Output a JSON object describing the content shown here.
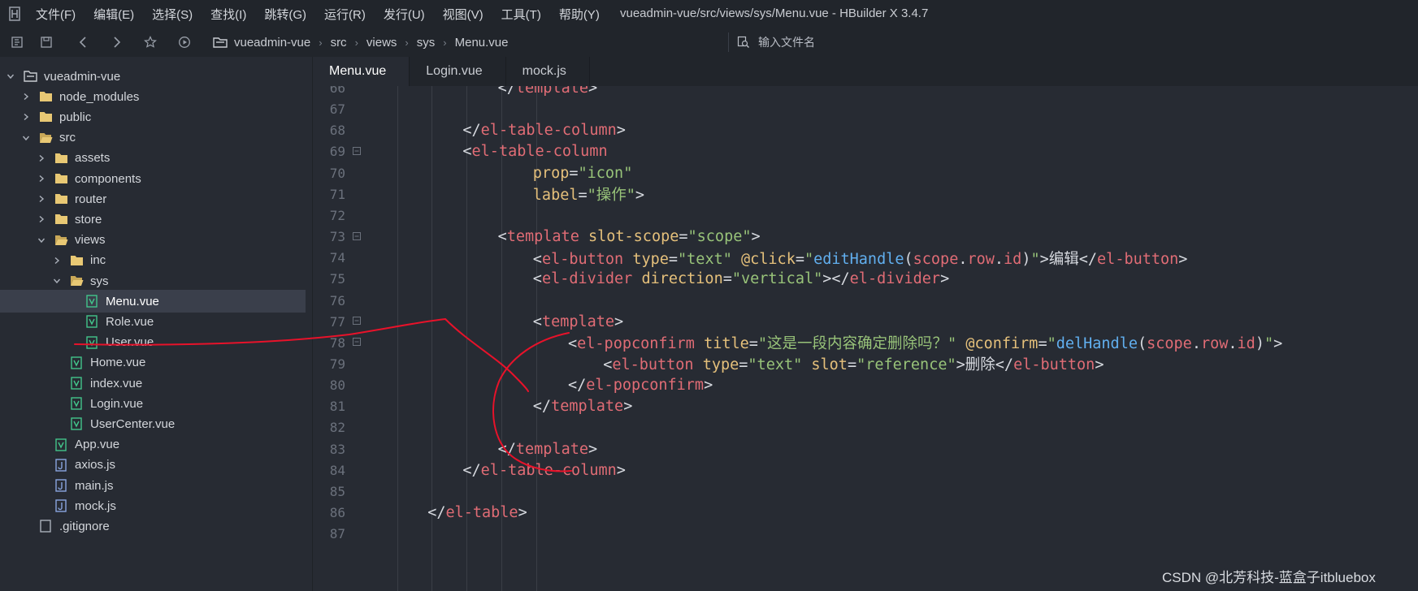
{
  "window": {
    "title": "vueadmin-vue/src/views/sys/Menu.vue - HBuilder X 3.4.7",
    "menu": [
      "文件(F)",
      "编辑(E)",
      "选择(S)",
      "查找(I)",
      "跳转(G)",
      "运行(R)",
      "发行(U)",
      "视图(V)",
      "工具(T)",
      "帮助(Y)"
    ]
  },
  "toolbar": {
    "icons": [
      "sidebar-toggle-icon",
      "save-icon",
      "back-icon",
      "forward-icon",
      "star-icon",
      "run-icon"
    ],
    "breadcrumb": [
      "vueadmin-vue",
      "src",
      "views",
      "sys",
      "Menu.vue"
    ],
    "search_placeholder": "输入文件名"
  },
  "sidebar": {
    "items": [
      {
        "label": "vueadmin-vue",
        "level": 0,
        "type": "project",
        "expanded": true
      },
      {
        "label": "node_modules",
        "level": 1,
        "type": "folder",
        "expanded": false
      },
      {
        "label": "public",
        "level": 1,
        "type": "folder",
        "expanded": false
      },
      {
        "label": "src",
        "level": 1,
        "type": "folder",
        "expanded": true
      },
      {
        "label": "assets",
        "level": 2,
        "type": "folder",
        "expanded": false
      },
      {
        "label": "components",
        "level": 2,
        "type": "folder",
        "expanded": false
      },
      {
        "label": "router",
        "level": 2,
        "type": "folder",
        "expanded": false
      },
      {
        "label": "store",
        "level": 2,
        "type": "folder",
        "expanded": false
      },
      {
        "label": "views",
        "level": 2,
        "type": "folder",
        "expanded": true
      },
      {
        "label": "inc",
        "level": 3,
        "type": "folder",
        "expanded": false
      },
      {
        "label": "sys",
        "level": 3,
        "type": "folder",
        "expanded": true
      },
      {
        "label": "Menu.vue",
        "level": 4,
        "type": "vue",
        "selected": true
      },
      {
        "label": "Role.vue",
        "level": 4,
        "type": "vue"
      },
      {
        "label": "User.vue",
        "level": 4,
        "type": "vue"
      },
      {
        "label": "Home.vue",
        "level": 3,
        "type": "vue"
      },
      {
        "label": "index.vue",
        "level": 3,
        "type": "vue"
      },
      {
        "label": "Login.vue",
        "level": 3,
        "type": "vue"
      },
      {
        "label": "UserCenter.vue",
        "level": 3,
        "type": "vue"
      },
      {
        "label": "App.vue",
        "level": 2,
        "type": "vue"
      },
      {
        "label": "axios.js",
        "level": 2,
        "type": "js"
      },
      {
        "label": "main.js",
        "level": 2,
        "type": "js"
      },
      {
        "label": "mock.js",
        "level": 2,
        "type": "js"
      },
      {
        "label": ".gitignore",
        "level": 1,
        "type": "file"
      }
    ]
  },
  "tabs": [
    {
      "label": "Menu.vue",
      "active": true
    },
    {
      "label": "Login.vue",
      "active": false
    },
    {
      "label": "mock.js",
      "active": false
    }
  ],
  "editor": {
    "lines": [
      {
        "n": "66",
        "fold": false,
        "indent": 12,
        "tokens": [
          [
            "br",
            "</"
          ],
          [
            "tag",
            "template"
          ],
          [
            "br",
            ">"
          ]
        ]
      },
      {
        "n": "67",
        "fold": false,
        "indent": 0,
        "tokens": []
      },
      {
        "n": "68",
        "fold": false,
        "indent": 8,
        "tokens": [
          [
            "br",
            "</"
          ],
          [
            "tag",
            "el-table-column"
          ],
          [
            "br",
            ">"
          ]
        ]
      },
      {
        "n": "69",
        "fold": true,
        "indent": 8,
        "tokens": [
          [
            "br",
            "<"
          ],
          [
            "tag",
            "el-table-column"
          ]
        ]
      },
      {
        "n": "70",
        "fold": false,
        "indent": 16,
        "tokens": [
          [
            "attr",
            "prop"
          ],
          [
            "br",
            "="
          ],
          [
            "str",
            "\"icon\""
          ]
        ]
      },
      {
        "n": "71",
        "fold": false,
        "indent": 16,
        "tokens": [
          [
            "attr",
            "label"
          ],
          [
            "br",
            "="
          ],
          [
            "str",
            "\"操作\""
          ],
          [
            "br",
            ">"
          ]
        ]
      },
      {
        "n": "72",
        "fold": false,
        "indent": 0,
        "tokens": []
      },
      {
        "n": "73",
        "fold": true,
        "indent": 12,
        "tokens": [
          [
            "br",
            "<"
          ],
          [
            "tag",
            "template"
          ],
          [
            "txt",
            " "
          ],
          [
            "attr",
            "slot-scope"
          ],
          [
            "br",
            "="
          ],
          [
            "str",
            "\"scope\""
          ],
          [
            "br",
            ">"
          ]
        ]
      },
      {
        "n": "74",
        "fold": false,
        "indent": 16,
        "tokens": [
          [
            "br",
            "<"
          ],
          [
            "tag",
            "el-button"
          ],
          [
            "txt",
            " "
          ],
          [
            "attr",
            "type"
          ],
          [
            "br",
            "="
          ],
          [
            "str",
            "\"text\""
          ],
          [
            "txt",
            " "
          ],
          [
            "dir",
            "@click"
          ],
          [
            "br",
            "="
          ],
          [
            "str",
            "\""
          ],
          [
            "fn",
            "editHandle"
          ],
          [
            "br",
            "("
          ],
          [
            "tag",
            "scope"
          ],
          [
            "br",
            "."
          ],
          [
            "tag",
            "row"
          ],
          [
            "br",
            "."
          ],
          [
            "tag",
            "id"
          ],
          [
            "br",
            ")"
          ],
          [
            "str",
            "\""
          ],
          [
            "br",
            ">"
          ],
          [
            "txt",
            "编辑"
          ],
          [
            "br",
            "</"
          ],
          [
            "tag",
            "el-button"
          ],
          [
            "br",
            ">"
          ]
        ]
      },
      {
        "n": "75",
        "fold": false,
        "indent": 16,
        "tokens": [
          [
            "br",
            "<"
          ],
          [
            "tag",
            "el-divider"
          ],
          [
            "txt",
            " "
          ],
          [
            "attr",
            "direction"
          ],
          [
            "br",
            "="
          ],
          [
            "str",
            "\"vertical\""
          ],
          [
            "br",
            "></"
          ],
          [
            "tag",
            "el-divider"
          ],
          [
            "br",
            ">"
          ]
        ]
      },
      {
        "n": "76",
        "fold": false,
        "indent": 0,
        "tokens": []
      },
      {
        "n": "77",
        "fold": true,
        "indent": 16,
        "tokens": [
          [
            "br",
            "<"
          ],
          [
            "tag",
            "template"
          ],
          [
            "br",
            ">"
          ]
        ]
      },
      {
        "n": "78",
        "fold": true,
        "indent": 20,
        "tokens": [
          [
            "br",
            "<"
          ],
          [
            "tag",
            "el-popconfirm"
          ],
          [
            "txt",
            " "
          ],
          [
            "attr",
            "title"
          ],
          [
            "br",
            "="
          ],
          [
            "str",
            "\"这是一段内容确定删除吗？\""
          ],
          [
            "txt",
            " "
          ],
          [
            "dir",
            "@confirm"
          ],
          [
            "br",
            "="
          ],
          [
            "str",
            "\""
          ],
          [
            "fn",
            "delHandle"
          ],
          [
            "br",
            "("
          ],
          [
            "tag",
            "scope"
          ],
          [
            "br",
            "."
          ],
          [
            "tag",
            "row"
          ],
          [
            "br",
            "."
          ],
          [
            "tag",
            "id"
          ],
          [
            "br",
            ")"
          ],
          [
            "str",
            "\""
          ],
          [
            "br",
            ">"
          ]
        ]
      },
      {
        "n": "79",
        "fold": false,
        "indent": 24,
        "tokens": [
          [
            "br",
            "<"
          ],
          [
            "tag",
            "el-button"
          ],
          [
            "txt",
            " "
          ],
          [
            "attr",
            "type"
          ],
          [
            "br",
            "="
          ],
          [
            "str",
            "\"text\""
          ],
          [
            "txt",
            " "
          ],
          [
            "attr",
            "slot"
          ],
          [
            "br",
            "="
          ],
          [
            "str",
            "\"reference\""
          ],
          [
            "br",
            ">"
          ],
          [
            "txt",
            "删除"
          ],
          [
            "br",
            "</"
          ],
          [
            "tag",
            "el-button"
          ],
          [
            "br",
            ">"
          ]
        ]
      },
      {
        "n": "80",
        "fold": false,
        "indent": 20,
        "tokens": [
          [
            "br",
            "</"
          ],
          [
            "tag",
            "el-popconfirm"
          ],
          [
            "br",
            ">"
          ]
        ]
      },
      {
        "n": "81",
        "fold": false,
        "indent": 16,
        "tokens": [
          [
            "br",
            "</"
          ],
          [
            "tag",
            "template"
          ],
          [
            "br",
            ">"
          ]
        ]
      },
      {
        "n": "82",
        "fold": false,
        "indent": 0,
        "tokens": []
      },
      {
        "n": "83",
        "fold": false,
        "indent": 12,
        "tokens": [
          [
            "br",
            "</"
          ],
          [
            "tag",
            "template"
          ],
          [
            "br",
            ">"
          ]
        ]
      },
      {
        "n": "84",
        "fold": false,
        "indent": 8,
        "tokens": [
          [
            "br",
            "</"
          ],
          [
            "tag",
            "el-table-column"
          ],
          [
            "br",
            ">"
          ]
        ]
      },
      {
        "n": "85",
        "fold": false,
        "indent": 0,
        "tokens": []
      },
      {
        "n": "86",
        "fold": false,
        "indent": 4,
        "tokens": [
          [
            "br",
            "</"
          ],
          [
            "tag",
            "el-table"
          ],
          [
            "br",
            ">"
          ]
        ]
      },
      {
        "n": "87",
        "fold": false,
        "indent": 0,
        "tokens": []
      }
    ]
  },
  "watermark": "CSDN @北芳科技-蓝盒子itbluebox",
  "colors": {
    "tag": "#e06c75",
    "attr": "#e5c07b",
    "string": "#98c379",
    "function": "#61afef",
    "annotation": "#e8122a",
    "background": "#272b33",
    "chrome": "#21252b"
  }
}
